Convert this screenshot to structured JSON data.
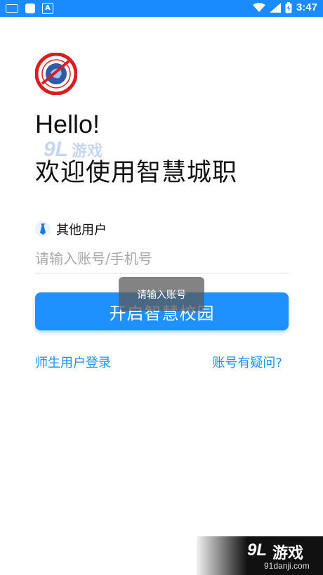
{
  "status_bar": {
    "time": "3:47",
    "app_icon_letter": "A",
    "background": "#1a8cff"
  },
  "logo": {
    "name": "school-emblem",
    "colors": {
      "ring": "#d81e1e",
      "center": "#2f5aa8"
    }
  },
  "greeting": "Hello!",
  "welcome": "欢迎使用智慧城职",
  "user_type": {
    "icon": "tie-icon",
    "label": "其他用户"
  },
  "account_input": {
    "value": "",
    "placeholder": "请输入账号/手机号"
  },
  "login_button": {
    "label": "开启智慧校园",
    "color": "#1e90ff"
  },
  "toast": "请输入账号",
  "links": {
    "left": "师生用户登录",
    "right": "账号有疑问?"
  },
  "watermark": {
    "logo": "9L",
    "brand": "游戏",
    "site": "91danji.com"
  }
}
